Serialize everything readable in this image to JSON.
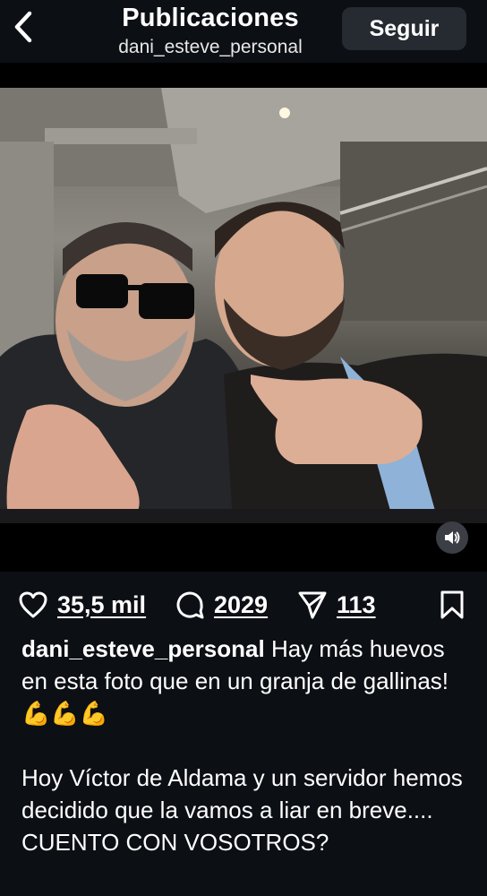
{
  "header": {
    "title": "Publicaciones",
    "subtitle": "dani_esteve_personal",
    "follow_label": "Seguir"
  },
  "media": {
    "sound_icon": "speaker-icon"
  },
  "actions": {
    "likes": "35,5 mil",
    "comments": "2029",
    "shares": "113"
  },
  "caption": {
    "username": "dani_esteve_personal",
    "text_1": "Hay más huevos en esta foto que en un granja de gallinas! 💪💪💪",
    "text_2": "Hoy Víctor de Aldama y un servidor hemos decidido que la vamos a liar en breve.... CUENTO CON VOSOTROS?"
  },
  "colors": {
    "background": "#0c0f14",
    "button": "#262a31",
    "text": "#ffffff"
  }
}
